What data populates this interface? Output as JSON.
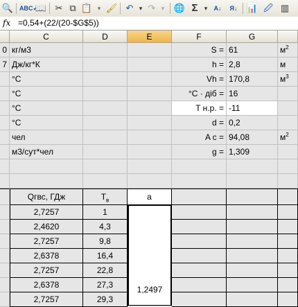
{
  "toolbar": {
    "icons": [
      "print-preview-icon",
      "spellcheck-icon",
      "research-icon",
      "cut-icon",
      "copy-icon",
      "paste-icon",
      "format-painter-icon",
      "undo-icon",
      "redo-icon",
      "hyperlink-icon",
      "autosum-icon",
      "sort-ascending-icon",
      "sort-descending-icon",
      "chart-wizard-icon",
      "drawing-icon"
    ],
    "autosum_glyph": "Σ",
    "sort_az": "А↓",
    "sort_za": "Я↓"
  },
  "formula_bar": {
    "fx_label": "fx",
    "formula": "=0,54+(22/(20-$G$5))"
  },
  "columns": {
    "c": "C",
    "d": "D",
    "e": "E",
    "f": "F",
    "g": "G"
  },
  "cells": {
    "c_r1_num": "0",
    "c_r1": "кг/м3",
    "c_r2_num": "7",
    "c_r2": "Дж/кг*К",
    "c_r3": "°С",
    "c_r4": "°С",
    "c_r5": "°С",
    "c_r6": "°С",
    "c_r7": "чел",
    "c_r8": "м3/сут*чел",
    "f_r1": "S =",
    "g_r1": "61",
    "h_r1": "м",
    "h_r1_sup": "2",
    "f_r2": "h =",
    "g_r2": "2,8",
    "h_r2": "м",
    "f_r3": "Vh =",
    "g_r3": "170,8",
    "h_r3": "м",
    "h_r3_sup": "3",
    "f_r4": "°С · діб =",
    "g_r4": "16",
    "f_r5": "T н.р. =",
    "g_r5": "-11",
    "f_r6": "d =",
    "g_r6": "0,2",
    "f_r7": "A с =",
    "g_r7": "94,08",
    "h_r7": "м",
    "h_r7_sup": "2",
    "f_r8": "g =",
    "g_r8": "1,309"
  },
  "table": {
    "header_c": "Qгвс, ГДж",
    "header_d": "T",
    "header_d_sub": "в",
    "header_e": "a",
    "rows": [
      {
        "q": "2,7257",
        "t": "1"
      },
      {
        "q": "2,4620",
        "t": "4,3"
      },
      {
        "q": "2,7257",
        "t": "9,8"
      },
      {
        "q": "2,6378",
        "t": "16,4"
      },
      {
        "q": "2,7257",
        "t": "22,8"
      },
      {
        "q": "2,6378",
        "t": "27,3"
      },
      {
        "q": "2,7257",
        "t": "29,3"
      }
    ],
    "merged_value": "1,2497"
  },
  "colors": {
    "selected_header": "#f0b64a",
    "grid_gray": "#e6e6e6"
  }
}
